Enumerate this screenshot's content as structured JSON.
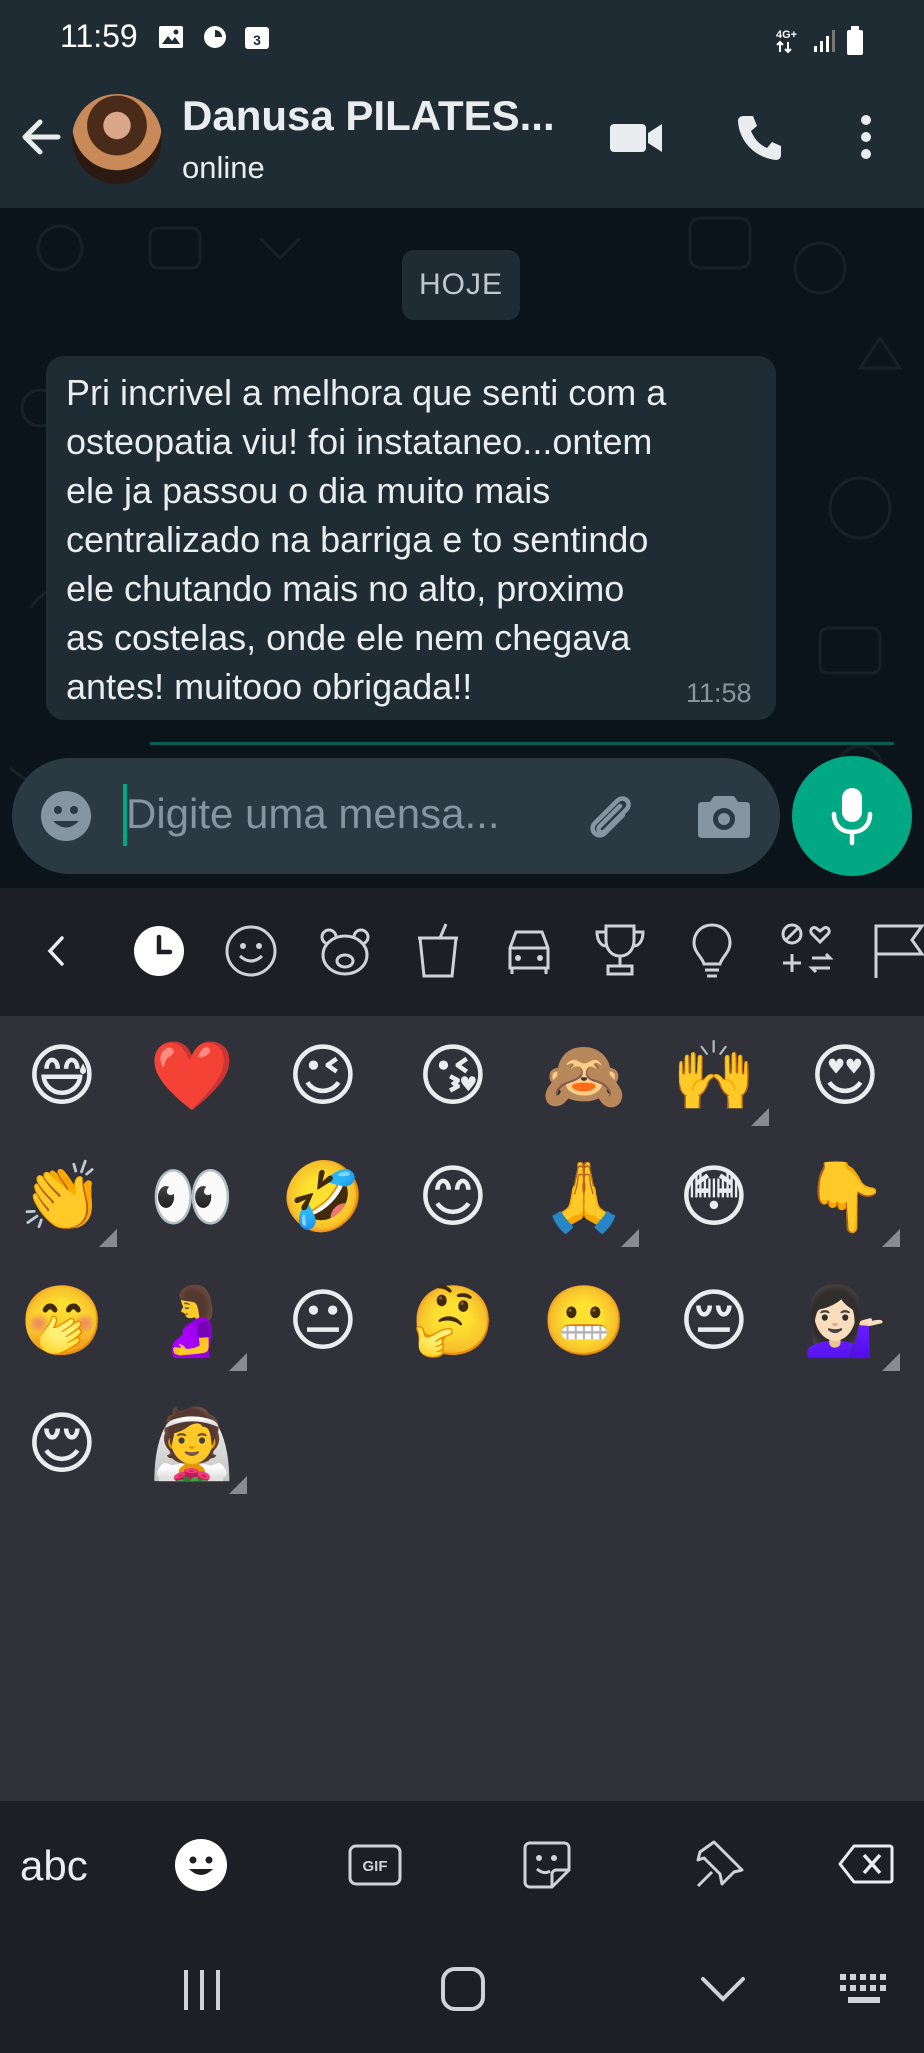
{
  "status_bar": {
    "time": "11:59",
    "network": "4G+",
    "calendar_day": "3"
  },
  "header": {
    "contact_name": "Danusa PILATES...",
    "contact_status": "online"
  },
  "chat": {
    "date_chip": "HOJE",
    "message": {
      "text": "Pri incrivel a melhora que senti com a\nosteopatia viu! foi instataneo...ontem\nele ja passou o dia muito mais\ncentralizado na barriga e to sentindo\nele chutando mais no alto, proximo\nas costelas, onde ele nem chegava\nantes! muitooo obrigada!!",
      "time": "11:58"
    }
  },
  "composer": {
    "placeholder": "Digite uma mensa..."
  },
  "emoji_categories": [
    "recent-icon",
    "smileys-icon",
    "animals-icon",
    "food-icon",
    "travel-icon",
    "activities-icon",
    "objects-icon",
    "symbols-icon",
    "flags-icon"
  ],
  "emoji_grid": [
    {
      "char": "😅",
      "variants": false
    },
    {
      "char": "❤️",
      "variants": false
    },
    {
      "char": "😉",
      "variants": false
    },
    {
      "char": "😘",
      "variants": false
    },
    {
      "char": "🙈",
      "variants": false
    },
    {
      "char": "🙌",
      "variants": true
    },
    {
      "char": "😍",
      "variants": false
    },
    {
      "char": "👏",
      "variants": true
    },
    {
      "char": "👀",
      "variants": false
    },
    {
      "char": "🤣",
      "variants": false
    },
    {
      "char": "😊",
      "variants": false
    },
    {
      "char": "🙏",
      "variants": true
    },
    {
      "char": "😳",
      "variants": false
    },
    {
      "char": "👇",
      "variants": true
    },
    {
      "char": "🤭",
      "variants": false
    },
    {
      "char": "🤰",
      "variants": true
    },
    {
      "char": "😐",
      "variants": false
    },
    {
      "char": "🤔",
      "variants": false
    },
    {
      "char": "😬",
      "variants": false
    },
    {
      "char": "😔",
      "variants": false
    },
    {
      "char": "💁🏻‍♀️",
      "variants": true
    },
    {
      "char": "😌",
      "variants": false
    },
    {
      "char": "👰",
      "variants": true
    }
  ],
  "keyboard": {
    "abc_label": "abc",
    "gif_label": "GIF"
  },
  "colors": {
    "accent": "#00a884",
    "header_bg": "#1f2c34",
    "chat_bg": "#0b141a",
    "panel_bg": "#313139"
  }
}
